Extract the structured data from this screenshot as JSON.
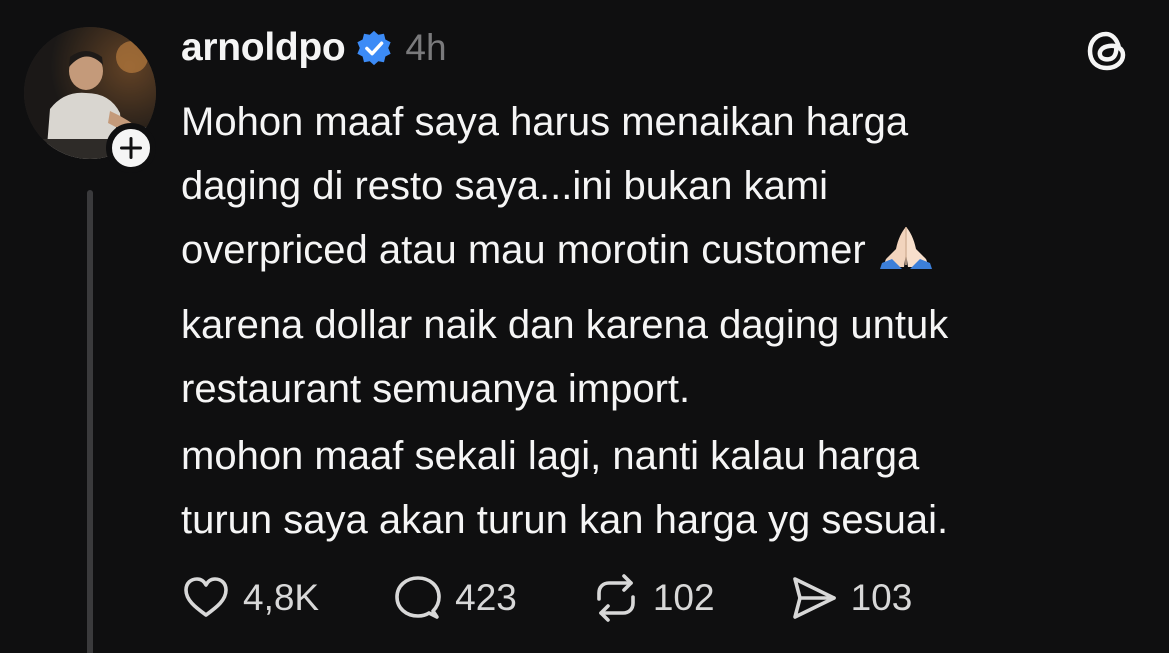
{
  "post": {
    "username": "arnoldpo",
    "time": "4h",
    "verified_color": "#3c8bf6",
    "paragraphs": [
      "Mohon maaf saya harus menaikan harga\ndaging di resto saya...ini bukan kami\noverpriced atau mau morotin customer",
      "karena dollar naik dan karena daging untuk\nrestaurant semuanya import.",
      "mohon maaf sekali lagi, nanti kalau harga\nturun saya akan turun kan harga yg sesuai."
    ],
    "emoji_icon": "folded-hands-icon"
  },
  "actions": {
    "likes": "4,8K",
    "replies": "423",
    "reposts": "102",
    "shares": "103"
  },
  "icons": {
    "like": "heart-icon",
    "reply": "speech-bubble-icon",
    "repost": "repost-icon",
    "share": "send-icon",
    "app": "threads-logo-icon",
    "follow": "plus-icon"
  }
}
